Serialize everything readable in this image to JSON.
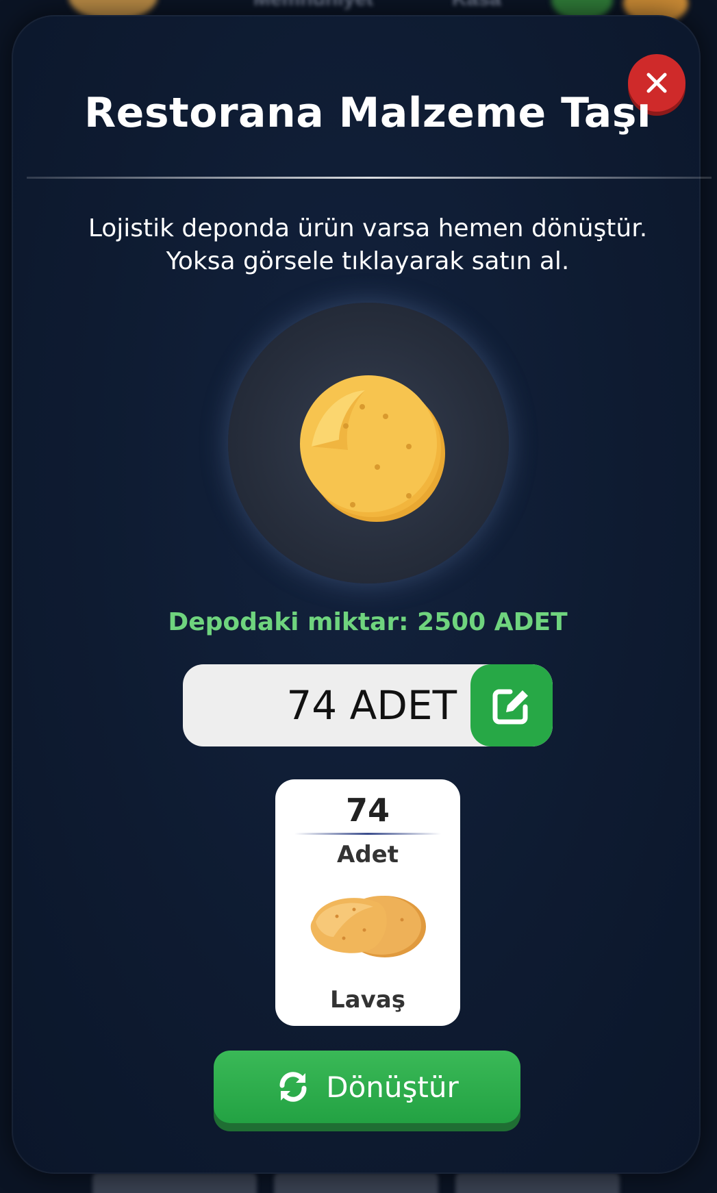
{
  "background": {
    "top_items": [
      "Memnuniyet",
      "Kasa"
    ]
  },
  "modal": {
    "title": "Restorana Malzeme Taşı",
    "description_lines": [
      "Lojistik deponda ürün varsa hemen dönüştür.",
      "Yoksa görsele tıklayarak satın al."
    ],
    "product_icon": "tortilla-stack-icon",
    "stock_text": "Depodaki miktar: 2500 ADET",
    "quantity_value": "74 ADET",
    "edit_icon": "edit-icon",
    "card": {
      "count": "74",
      "unit": "Adet",
      "name": "Lavaş",
      "icon": "lavash-icon"
    },
    "convert_label": "Dönüştür",
    "convert_icon": "refresh-icon",
    "close_icon": "close-icon"
  },
  "colors": {
    "modal_bg": "#0e1b31",
    "accent_green": "#27a846",
    "stock_green": "#6fd47e",
    "close_red": "#cf2a2a"
  }
}
